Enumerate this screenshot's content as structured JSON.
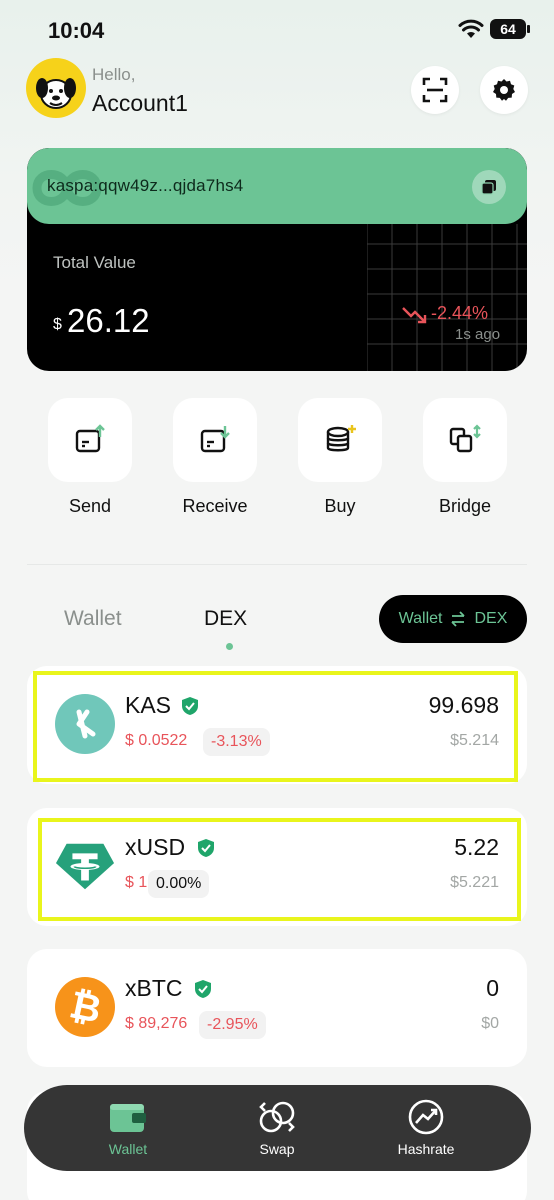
{
  "status_bar": {
    "time": "10:04",
    "battery": "64"
  },
  "header": {
    "greeting": "Hello,",
    "account_name": "Account1"
  },
  "balance_card": {
    "address": "kaspa:qqw49z...qjda7hs4",
    "total_label": "Total Value",
    "currency_symbol": "$",
    "total_value": "26.12",
    "change_percent": "-2.44%",
    "updated": "1s ago"
  },
  "actions": [
    {
      "label": "Send",
      "icon": "send-icon"
    },
    {
      "label": "Receive",
      "icon": "receive-icon"
    },
    {
      "label": "Buy",
      "icon": "buy-icon"
    },
    {
      "label": "Bridge",
      "icon": "bridge-icon"
    }
  ],
  "tabs": {
    "wallet": "Wallet",
    "dex": "DEX",
    "active": "DEX"
  },
  "switch": {
    "left": "Wallet",
    "right": "DEX"
  },
  "tokens": [
    {
      "name": "KAS",
      "price": "$ 0.0522",
      "change": "-3.13%",
      "amount": "99.698",
      "usd": "$5.214",
      "logo_color": "#70c7ba"
    },
    {
      "name": "xUSD",
      "price": "$ 1",
      "change": "0.00%",
      "amount": "5.22",
      "usd": "$5.221",
      "logo_color": "#26a17b"
    },
    {
      "name": "xBTC",
      "price": "$ 89,276",
      "change": "-2.95%",
      "amount": "0",
      "usd": "$0",
      "logo_color": "#f7931a"
    }
  ],
  "bottom_nav": [
    {
      "label": "Wallet",
      "icon": "wallet-icon",
      "active": true
    },
    {
      "label": "Swap",
      "icon": "swap-icon",
      "active": false
    },
    {
      "label": "Hashrate",
      "icon": "hashrate-icon",
      "active": false
    }
  ],
  "colors": {
    "accent": "#6cc495",
    "negative": "#e8545a",
    "highlight": "#e9f51c"
  }
}
